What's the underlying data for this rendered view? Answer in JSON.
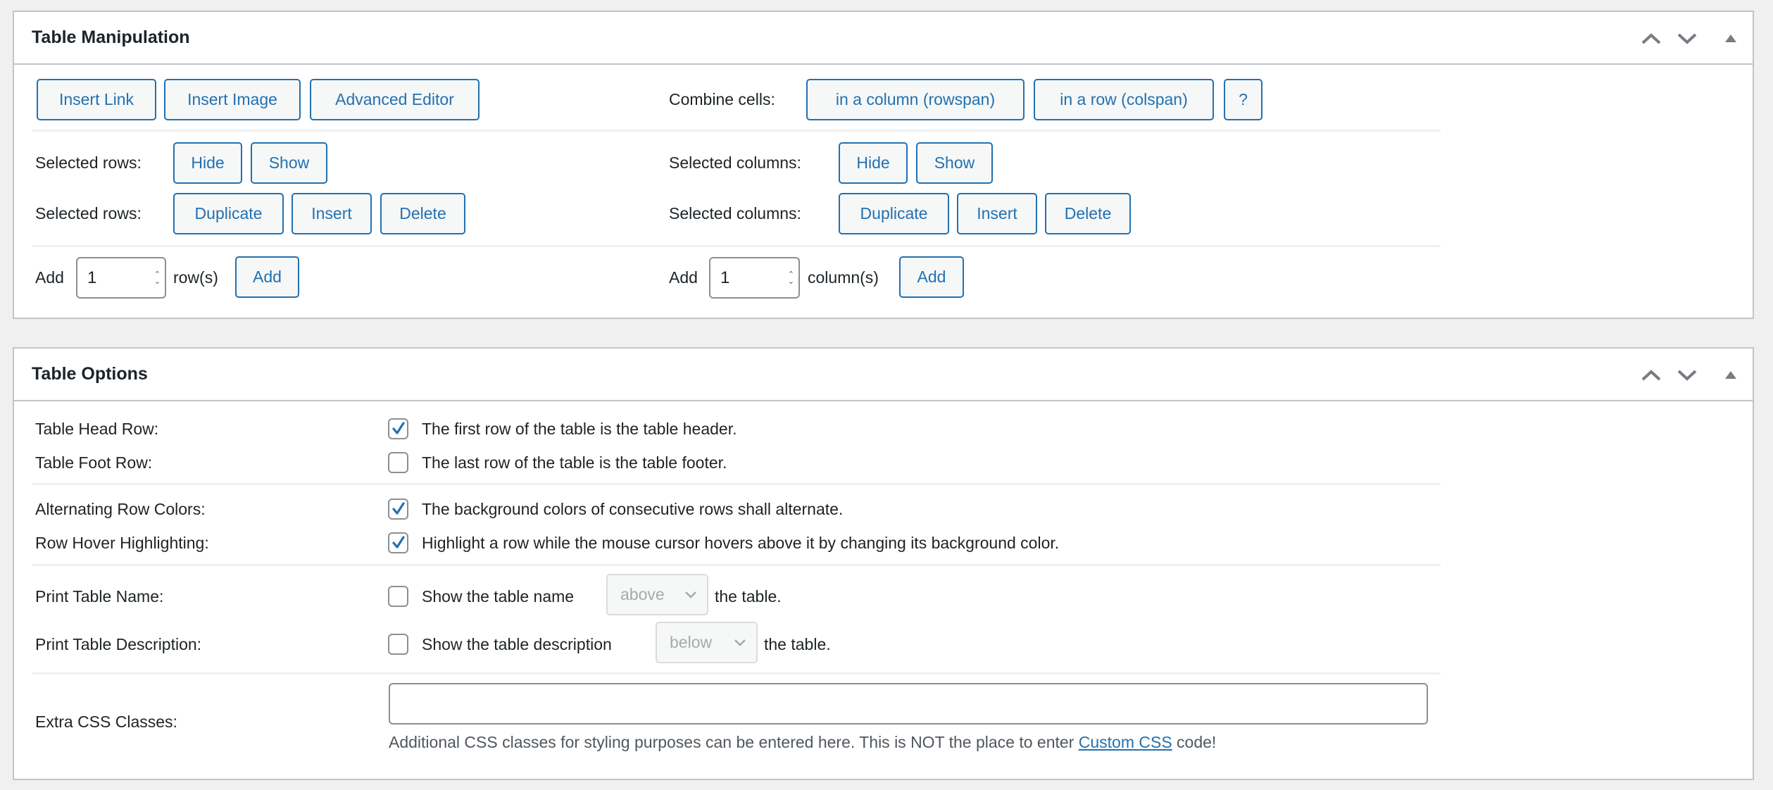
{
  "manipulation": {
    "title": "Table Manipulation",
    "header_icons": [
      "chevron-up-icon",
      "chevron-down-icon",
      "triangle-up-icon"
    ],
    "insert_link": "Insert Link",
    "insert_image": "Insert Image",
    "advanced_editor": "Advanced Editor",
    "combine_label": "Combine cells:",
    "rowspan": "in a column (rowspan)",
    "colspan": "in a row (colspan)",
    "help": "?",
    "sel_rows_label": "Selected rows:",
    "sel_cols_label": "Selected columns:",
    "hide": "Hide",
    "show": "Show",
    "duplicate": "Duplicate",
    "insert": "Insert",
    "delete": "Delete",
    "add_label": "Add",
    "rows_value": "1",
    "rows_unit": "row(s)",
    "cols_value": "1",
    "cols_unit": "column(s)",
    "add_button": "Add"
  },
  "options": {
    "title": "Table Options",
    "head_row_label": "Table Head Row:",
    "head_row_text": "The first row of the table is the table header.",
    "head_row_checked": true,
    "foot_row_label": "Table Foot Row:",
    "foot_row_text": "The last row of the table is the table footer.",
    "foot_row_checked": false,
    "alt_label": "Alternating Row Colors:",
    "alt_text": "The background colors of consecutive rows shall alternate.",
    "alt_checked": true,
    "hover_label": "Row Hover Highlighting:",
    "hover_text": "Highlight a row while the mouse cursor hovers above it by changing its background color.",
    "hover_checked": true,
    "name_label": "Print Table Name:",
    "name_text": "Show the table name",
    "name_position": "above",
    "name_suffix": "the table.",
    "name_checked": false,
    "desc_label": "Print Table Description:",
    "desc_text": "Show the table description",
    "desc_position": "below",
    "desc_suffix": "the table.",
    "desc_checked": false,
    "css_label": "Extra CSS Classes:",
    "css_value": "",
    "css_help_before": "Additional CSS classes for styling purposes can be entered here. This is NOT the place to enter ",
    "css_help_link": "Custom CSS",
    "css_help_after": " code!"
  },
  "colors": {
    "accent": "#2271b1",
    "border": "#c3c4c7",
    "background": "#f0f0f1"
  }
}
